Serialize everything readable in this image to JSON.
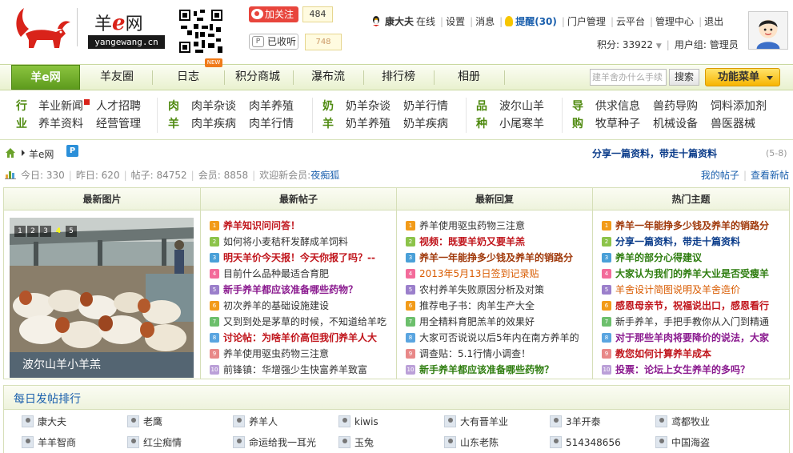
{
  "header": {
    "logo_text_a": "羊",
    "logo_text_e": "e",
    "logo_text_b": "网",
    "logo_domain": "yangewang.cn",
    "weibo_label": "加关注",
    "weibo_count": "484",
    "tq_label": "已收听",
    "tq_count": "748"
  },
  "user": {
    "name": "康大夫",
    "status": "在线",
    "settings": "设置",
    "messages": "消息",
    "remind": "提醒(30)",
    "portal_admin": "门户管理",
    "cloud": "云平台",
    "admin_center": "管理中心",
    "logout": "退出",
    "points_label": "积分: 33922",
    "group_label": "用户组: 管理员"
  },
  "nav": {
    "items": [
      "羊e网",
      "羊友圈",
      "日志",
      "积分商城",
      "瀑布流",
      "排行榜",
      "相册"
    ],
    "new_badge": "NEW",
    "search_placeholder": "建羊舍办什么手续",
    "search_button": "搜索",
    "func_menu": "功能菜单"
  },
  "categories": {
    "g1": {
      "label_top": "行",
      "label_bottom": "业",
      "links": [
        "羊业新闻",
        "人才招聘",
        "养羊资料",
        "经营管理"
      ]
    },
    "g2": {
      "label_top": "肉",
      "label_bottom": "羊",
      "links": [
        "肉羊杂谈",
        "肉羊养殖",
        "肉羊疾病",
        "肉羊行情"
      ]
    },
    "g3": {
      "label_top": "奶",
      "label_bottom": "羊",
      "links": [
        "奶羊杂谈",
        "奶羊行情",
        "奶羊养殖",
        "奶羊疾病"
      ]
    },
    "g4": {
      "label_top": "品",
      "label_bottom": "种",
      "links": [
        "波尔山羊",
        "小尾寒羊"
      ]
    },
    "g5": {
      "label_top": "导",
      "label_bottom": "购",
      "links": [
        "供求信息",
        "兽药导购",
        "饲料添加剂",
        "牧草种子",
        "机械设备",
        "兽医器械"
      ]
    }
  },
  "breadcrumb": {
    "current": "羊e网",
    "p_icon": "P",
    "promo": "分享一篇资料，带走十篇资料",
    "promo_page": "(5-8)"
  },
  "stats": {
    "today": "今日: 330",
    "yesterday": "昨日: 620",
    "posts": "帖子: 84752",
    "members": "会员: 8858",
    "welcome": "欢迎新会员:",
    "newbie": "夜痴狐",
    "my_posts": "我的帖子",
    "view_new": "查看新帖"
  },
  "boxes": {
    "latest_images": {
      "title": "最新图片",
      "slide_numbers": [
        "1",
        "2",
        "3",
        "4",
        "5"
      ],
      "active_slide": 3,
      "caption": "波尔山羊小羊羔"
    },
    "latest_posts": {
      "title": "最新帖子",
      "rows": [
        {
          "n": "1",
          "t": "养羊知识问问答！",
          "c": "red"
        },
        {
          "n": "2",
          "t": "如何将小麦秸秆发酵成羊饲料",
          "c": "dark"
        },
        {
          "n": "3",
          "t": "明天羊价今天报！今天你报了吗？--",
          "c": "red"
        },
        {
          "n": "4",
          "t": "目前什么品种最适合育肥",
          "c": "dark"
        },
        {
          "n": "5",
          "t": "新手养羊都应该准备哪些药物？",
          "c": "purple"
        },
        {
          "n": "6",
          "t": "初次养羊的基础设施建设",
          "c": "dark"
        },
        {
          "n": "7",
          "t": "又到到处是茅草的时候，不知道给羊吃",
          "c": "dark"
        },
        {
          "n": "8",
          "t": "讨论帖：为啥羊价高但我们养羊人大",
          "c": "red"
        },
        {
          "n": "9",
          "t": "养羊使用驱虫药物三注意",
          "c": "dark"
        },
        {
          "n": "10",
          "t": "前锋镇：华增强少生快富养羊致富",
          "c": "dark"
        }
      ]
    },
    "latest_replies": {
      "title": "最新回复",
      "rows": [
        {
          "n": "1",
          "t": "养羊使用驱虫药物三注意",
          "c": "dark"
        },
        {
          "n": "2",
          "t": "视频：既要羊奶又要羊羔",
          "c": "red"
        },
        {
          "n": "3",
          "t": "养羊一年能挣多少钱及养羊的销路分",
          "c": "brown"
        },
        {
          "n": "4",
          "t": "2013年5月13日签到记录贴",
          "c": "orange"
        },
        {
          "n": "5",
          "t": "农村养羊失败原因分析及对策",
          "c": "dark"
        },
        {
          "n": "6",
          "t": "推荐电子书：肉羊生产大全",
          "c": "dark"
        },
        {
          "n": "7",
          "t": "用全精料育肥羔羊的效果好",
          "c": "dark"
        },
        {
          "n": "8",
          "t": "大家可否说说以后5年内在南方养羊的",
          "c": "dark"
        },
        {
          "n": "9",
          "t": "调查贴：5.1行情小调查！",
          "c": "dark"
        },
        {
          "n": "10",
          "t": "新手养羊都应该准备哪些药物？",
          "c": "green"
        }
      ]
    },
    "hot_topics": {
      "title": "热门主题",
      "rows": [
        {
          "n": "1",
          "t": "养羊一年能挣多少钱及养羊的销路分",
          "c": "brown"
        },
        {
          "n": "2",
          "t": "分享一篇资料，带走十篇资料",
          "c": "blue"
        },
        {
          "n": "3",
          "t": "养羊的部分心得建议",
          "c": "green"
        },
        {
          "n": "4",
          "t": "大家认为我们的养羊大业是否受瘦羊",
          "c": "green"
        },
        {
          "n": "5",
          "t": "羊舍设计简图说明及羊舍造价",
          "c": "orange"
        },
        {
          "n": "6",
          "t": "感恩母亲节，祝福说出口，感恩看行",
          "c": "red"
        },
        {
          "n": "7",
          "t": "新手养羊，手把手教你从入门到精通",
          "c": "dark"
        },
        {
          "n": "8",
          "t": "对于那些羊肉将要降价的说法，大家",
          "c": "purple"
        },
        {
          "n": "9",
          "t": "教您如何计算养羊成本",
          "c": "red"
        },
        {
          "n": "10",
          "t": "投票：论坛上女生养羊的多吗？",
          "c": "purple"
        }
      ]
    }
  },
  "daily": {
    "title": "每日发帖排行",
    "row1": [
      "康大夫",
      "老鹰",
      "养羊人",
      "kiwis",
      "大有晋羊业",
      "3羊开泰",
      "鸢都牧业"
    ],
    "row2": [
      "羊羊智商",
      "红尘痴情",
      "命运给我一耳光",
      "玉兔",
      "山东老陈",
      "514348656",
      "中国海盗"
    ]
  },
  "colors": {
    "accent_green": "#5e9b1d",
    "brand_red": "#d9231a",
    "link_blue": "#1a5fad"
  }
}
